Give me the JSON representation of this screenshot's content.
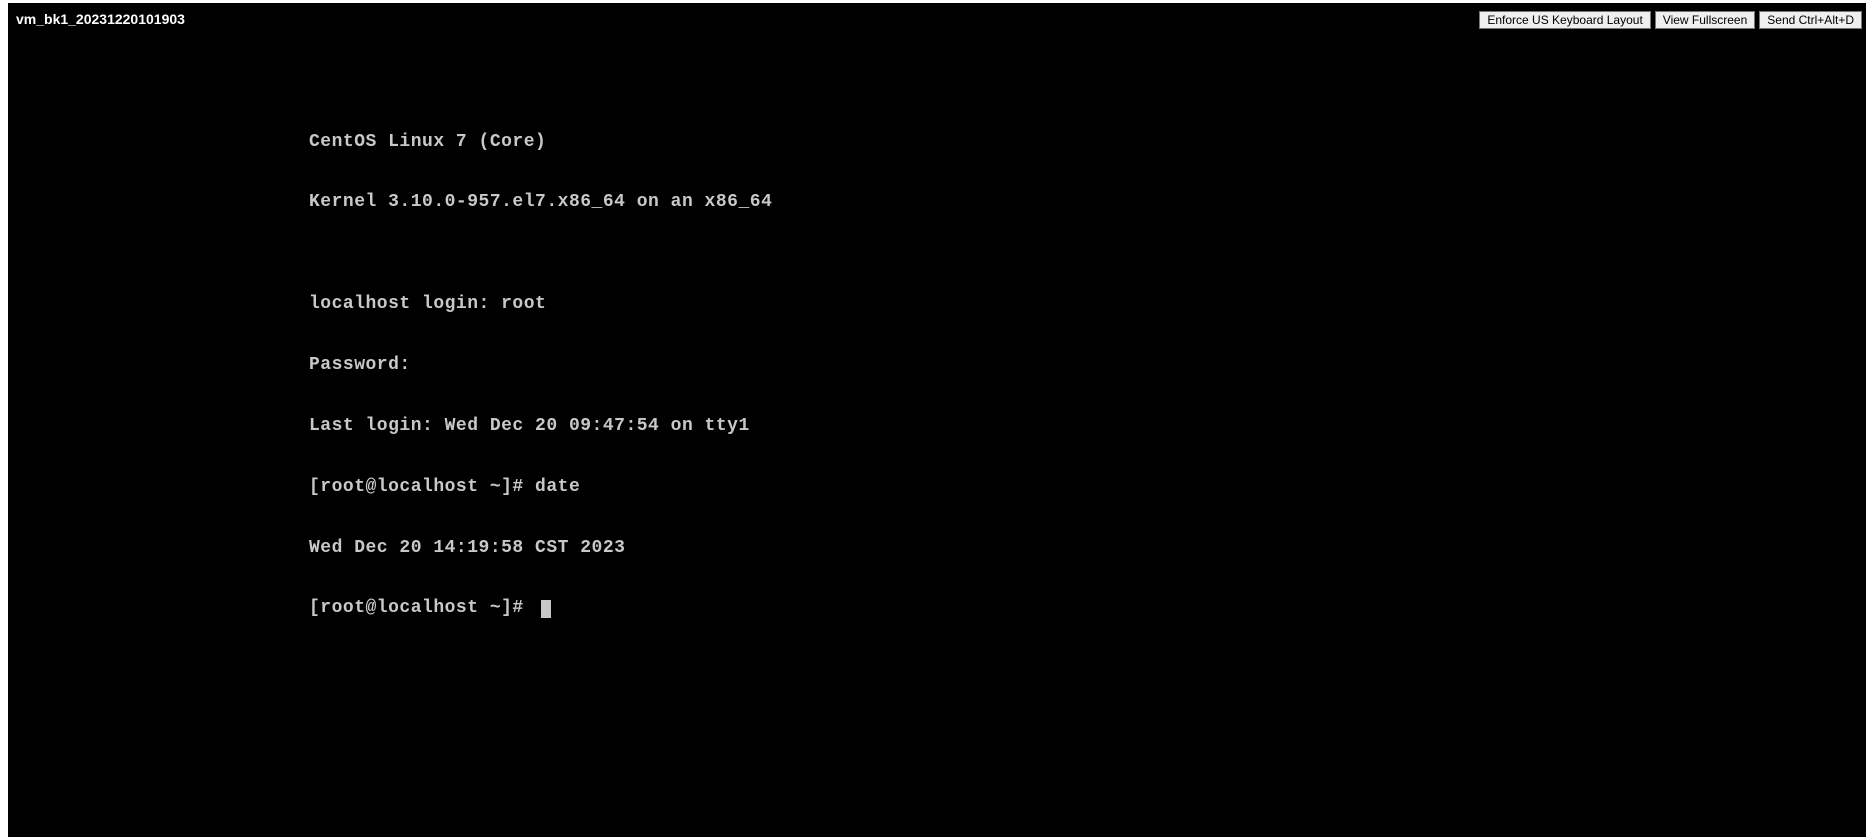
{
  "header": {
    "vm_name": "vm_bk1_20231220101903",
    "buttons": {
      "enforce_layout": "Enforce US Keyboard Layout",
      "view_fullscreen": "View Fullscreen",
      "send_ctrl_alt_del": "Send Ctrl+Alt+D"
    }
  },
  "terminal": {
    "lines": [
      "CentOS Linux 7 (Core)",
      "Kernel 3.10.0-957.el7.x86_64 on an x86_64",
      "",
      "localhost login: root",
      "Password:",
      "Last login: Wed Dec 20 09:47:54 on tty1",
      "[root@localhost ~]# date",
      "Wed Dec 20 14:19:58 CST 2023",
      "[root@localhost ~]# "
    ]
  }
}
